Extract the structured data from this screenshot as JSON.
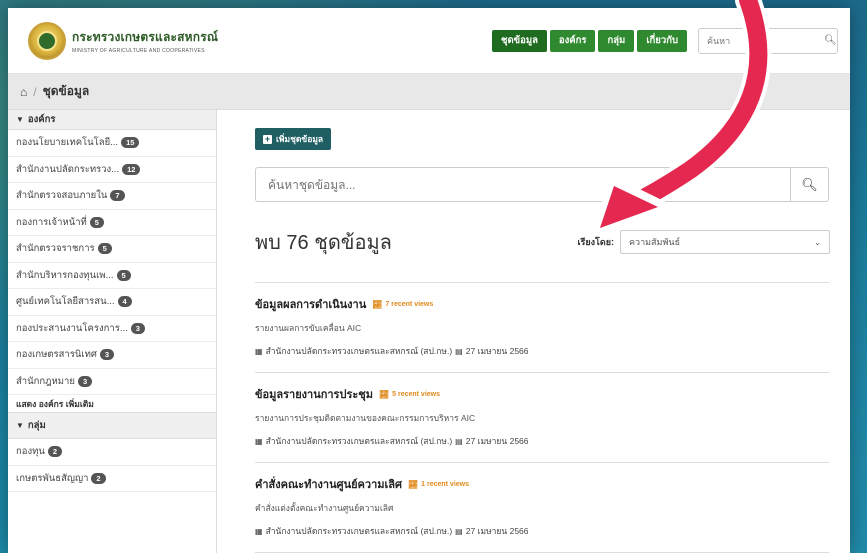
{
  "header": {
    "logo_th": "กระทรวงเกษตรและสหกรณ์",
    "logo_en": "MINISTRY OF AGRICULTURE AND COOPERATIVES",
    "nav": [
      {
        "label": "ชุดข้อมูล"
      },
      {
        "label": "องค์กร"
      },
      {
        "label": "กลุ่ม"
      },
      {
        "label": "เกี่ยวกับ"
      }
    ],
    "search_placeholder": "ค้นหา"
  },
  "breadcrumb": {
    "current": "ชุดข้อมูล"
  },
  "sidebar": {
    "org_heading": "องค์กร",
    "orgs": [
      {
        "label": "กองนโยบายเทคโนโลยี...",
        "count": "15"
      },
      {
        "label": "สำนักงานปลัดกระทรวง...",
        "count": "12"
      },
      {
        "label": "สำนักตรวจสอบภายใน",
        "count": "7"
      },
      {
        "label": "กองการเจ้าหน้าที่",
        "count": "5"
      },
      {
        "label": "สำนักตรวจราชการ",
        "count": "5"
      },
      {
        "label": "สำนักบริหารกองทุนเพ...",
        "count": "5"
      },
      {
        "label": "ศูนย์เทคโนโลยีสารสน...",
        "count": "4"
      },
      {
        "label": "กองประสานงานโครงการ...",
        "count": "3"
      },
      {
        "label": "กองเกษตรสารนิเทศ",
        "count": "3"
      },
      {
        "label": "สำนักกฎหมาย",
        "count": "3"
      }
    ],
    "show_more": "แสดง องค์กร เพิ่มเติม",
    "group_heading": "กลุ่ม",
    "groups": [
      {
        "label": "กองทุน",
        "count": "2"
      },
      {
        "label": "เกษตรพันธสัญญา",
        "count": "2"
      }
    ]
  },
  "main": {
    "add_button": "เพิ่มชุดข้อมูล",
    "search_placeholder": "ค้นหาชุดข้อมูล...",
    "results_title": "พบ 76 ชุดข้อมูล",
    "sort_label": "เรียงโดย:",
    "sort_value": "ความสัมพันธ์",
    "datasets": [
      {
        "title": "ข้อมูลผลการดำเนินงาน",
        "recent": "7 recent views",
        "desc": "รายงานผลการขับเคลื่อน AIC",
        "org": "สำนักงานปลัดกระทรวงเกษตรและสหกรณ์ (สป.กษ.)",
        "date": "27 เมษายน 2566"
      },
      {
        "title": "ข้อมูลรายงานการประชุม",
        "recent": "5 recent views",
        "desc": "รายงานการประชุมติดตามงานของคณะกรรมการบริหาร AIC",
        "org": "สำนักงานปลัดกระทรวงเกษตรและสหกรณ์ (สป.กษ.)",
        "date": "27 เมษายน 2566"
      },
      {
        "title": "คำสั่งคณะทำงานศูนย์ความเลิศ",
        "recent": "1 recent views",
        "desc": "คำสั่งแต่งตั้งคณะทำงานศูนย์ความเลิศ",
        "org": "สำนักงานปลัดกระทรวงเกษตรและสหกรณ์ (สป.กษ.)",
        "date": "27 เมษายน 2566"
      }
    ]
  },
  "colors": {
    "nav_green": "#2f8a2f",
    "add_button": "#1f5e63",
    "recent_orange": "#e08a1c",
    "arrow": "#e5284f"
  }
}
